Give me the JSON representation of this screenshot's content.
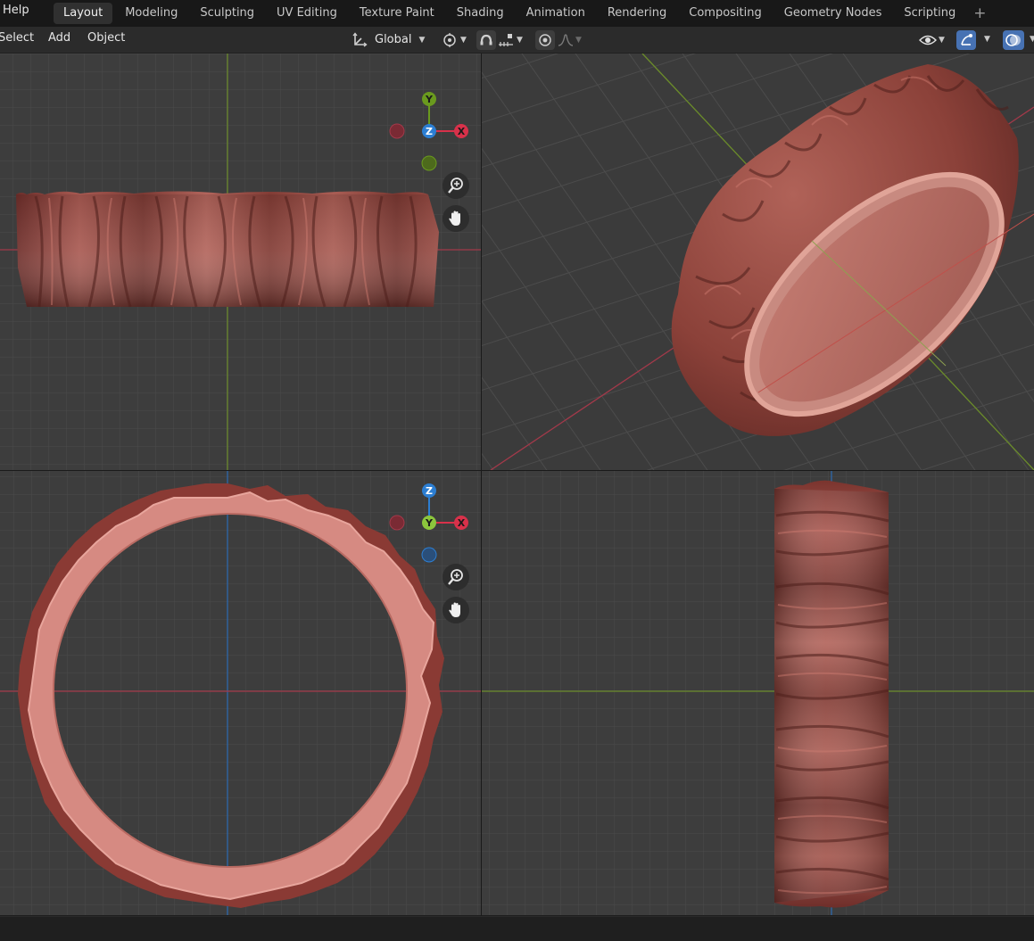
{
  "topbar": {
    "help_label": "Help",
    "tabs": [
      {
        "label": "Layout"
      },
      {
        "label": "Modeling"
      },
      {
        "label": "Sculpting"
      },
      {
        "label": "UV Editing"
      },
      {
        "label": "Texture Paint"
      },
      {
        "label": "Shading"
      },
      {
        "label": "Animation"
      },
      {
        "label": "Rendering"
      },
      {
        "label": "Compositing"
      },
      {
        "label": "Geometry Nodes"
      },
      {
        "label": "Scripting"
      }
    ],
    "add_tab": "+"
  },
  "header": {
    "select_label": "Select",
    "add_label": "Add",
    "object_label": "Object",
    "transform_orientation": "Global"
  },
  "icons": {
    "transform": "transform-orientation-icon",
    "pivot": "pivot-point-icon",
    "snap": "snap-icon",
    "snap_increment": "snap-increment-icon",
    "proportional": "proportional-editing-icon",
    "falloff": "falloff-curve-icon",
    "visibility": "visibility-eye-icon",
    "gizmo": "gizmo-toggle-icon",
    "overlay": "overlay-icon",
    "zoom": "zoom-icon",
    "pan": "pan-hand-icon"
  },
  "gizmo_top_left": {
    "y": "Y",
    "z": "Z",
    "x": "X"
  },
  "gizmo_bottom_left": {
    "z": "Z",
    "y": "Y",
    "x": "X"
  },
  "colors": {
    "accent": "#4772b3",
    "x_axis": "#d8314a",
    "y_axis": "#6a9a1e",
    "z_axis": "#2c7ed2",
    "ring_surface": "#9a4a42",
    "ring_inner": "#d8928a"
  }
}
